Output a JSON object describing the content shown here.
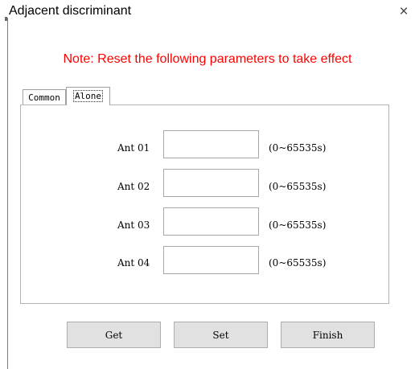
{
  "window": {
    "title": "Adjacent discriminant",
    "close_glyph": "×"
  },
  "note": "Note: Reset the following parameters to take effect",
  "tabs": [
    {
      "label": "Common",
      "active": false
    },
    {
      "label": "Alone",
      "active": true
    }
  ],
  "rows": [
    {
      "label": "Ant 01",
      "value": "",
      "range": "(0~65535s)"
    },
    {
      "label": "Ant 02",
      "value": "",
      "range": "(0~65535s)"
    },
    {
      "label": "Ant 03",
      "value": "",
      "range": "(0~65535s)"
    },
    {
      "label": "Ant 04",
      "value": "",
      "range": "(0~65535s)"
    }
  ],
  "buttons": {
    "get": "Get",
    "set": "Set",
    "finish": "Finish"
  },
  "colors": {
    "note": "#ff0000",
    "button_bg": "#e1e1e1"
  },
  "icons": {
    "close": "close-icon"
  }
}
